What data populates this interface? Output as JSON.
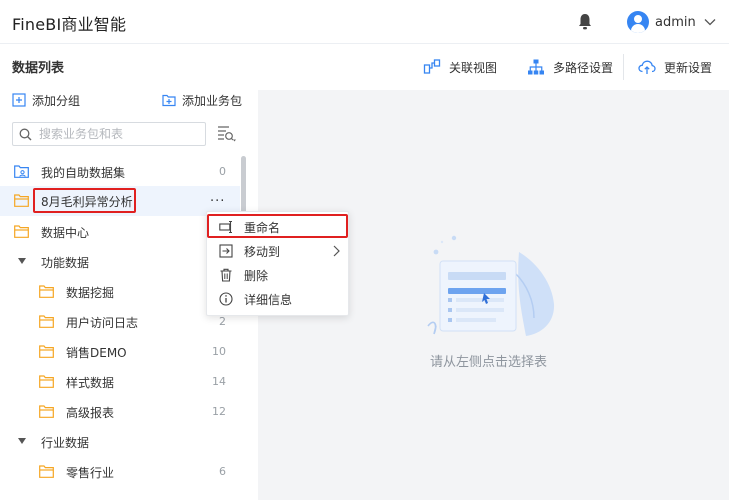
{
  "header": {
    "app_title": "FineBI商业智能",
    "username": "admin"
  },
  "page": {
    "title": "数据列表",
    "actions": {
      "relation_view": "关联视图",
      "multipath": "多路径设置",
      "update_settings": "更新设置"
    }
  },
  "sidebar": {
    "add_group": "添加分组",
    "add_package": "添加业务包",
    "search_placeholder": "搜索业务包和表",
    "items": [
      {
        "label": "我的自助数据集",
        "count": "0"
      },
      {
        "label": "8月毛利异常分析",
        "count": ""
      },
      {
        "label": "数据中心",
        "count": ""
      },
      {
        "label": "功能数据",
        "count": ""
      },
      {
        "label": "数据挖掘",
        "count": ""
      },
      {
        "label": "用户访问日志",
        "count": "2"
      },
      {
        "label": "销售DEMO",
        "count": "10"
      },
      {
        "label": "样式数据",
        "count": "14"
      },
      {
        "label": "高级报表",
        "count": "12"
      },
      {
        "label": "行业数据",
        "count": ""
      },
      {
        "label": "零售行业",
        "count": "6"
      }
    ]
  },
  "context_menu": {
    "items": [
      {
        "label": "重命名"
      },
      {
        "label": "移动到"
      },
      {
        "label": "删除"
      },
      {
        "label": "详细信息"
      }
    ]
  },
  "main": {
    "empty_text": "请从左侧点击选择表"
  },
  "colors": {
    "accent": "#3685f2",
    "folder": "#f5a623",
    "highlight": "#e02020"
  }
}
